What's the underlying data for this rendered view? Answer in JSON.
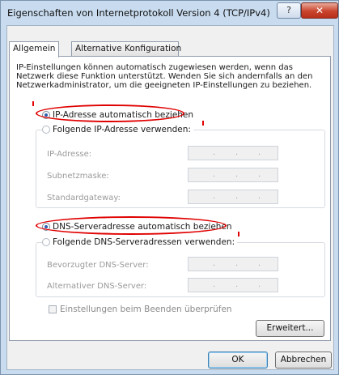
{
  "window": {
    "title": "Eigenschaften von Internetprotokoll Version 4 (TCP/IPv4)",
    "help_label": "?",
    "close_label": "✕"
  },
  "tabs": [
    {
      "label": "Allgemein",
      "active": true
    },
    {
      "label": "Alternative Konfiguration",
      "active": false
    }
  ],
  "description": "IP-Einstellungen können automatisch zugewiesen werden, wenn das Netzwerk diese Funktion unterstützt. Wenden Sie sich andernfalls an den Netzwerkadministrator, um die geeigneten IP-Einstellungen zu beziehen.",
  "ip": {
    "auto_label": "IP-Adresse automatisch beziehen",
    "auto_selected": true,
    "manual_label": "Folgende IP-Adresse verwenden:",
    "fields": [
      {
        "label": "IP-Adresse:",
        "value": ". . ."
      },
      {
        "label": "Subnetzmaske:",
        "value": ". . ."
      },
      {
        "label": "Standardgateway:",
        "value": ". . ."
      }
    ]
  },
  "dns": {
    "auto_label": "DNS-Serveradresse automatisch beziehen",
    "auto_selected": true,
    "manual_label": "Folgende DNS-Serveradressen verwenden:",
    "fields": [
      {
        "label": "Bevorzugter DNS-Server:",
        "value": ". . ."
      },
      {
        "label": "Alternativer DNS-Server:",
        "value": ". . ."
      }
    ]
  },
  "validate_label": "Einstellungen beim Beenden überprüfen",
  "buttons": {
    "advanced": "Erweitert...",
    "ok": "OK",
    "cancel": "Abbrechen"
  },
  "highlight_color": "#e00000"
}
